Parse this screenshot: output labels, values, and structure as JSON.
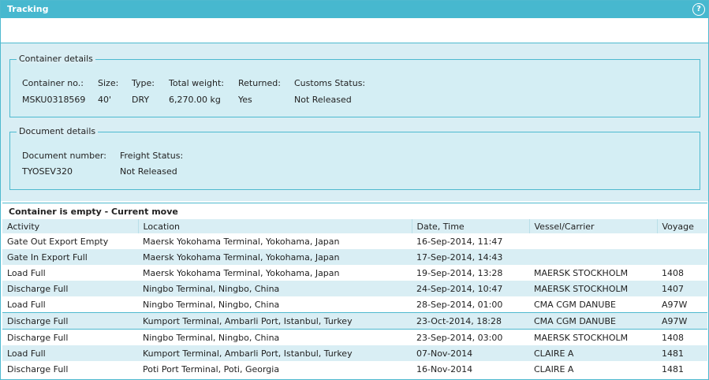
{
  "header": {
    "title": "Tracking",
    "help_icon": "?"
  },
  "container_details": {
    "legend": "Container details",
    "labels": [
      "Container no.:",
      "Size:",
      "Type:",
      "Total weight:",
      "Returned:",
      "Customs Status:"
    ],
    "values": [
      "MSKU0318569",
      "40'",
      "DRY",
      "6,270.00 kg",
      "Yes",
      "Not Released"
    ]
  },
  "document_details": {
    "legend": "Document details",
    "labels": [
      "Document number:",
      "Freight Status:"
    ],
    "values": [
      "TYOSEV320",
      "Not Released"
    ]
  },
  "moves": {
    "heading": "Container is empty - Current move",
    "columns": [
      "Activity",
      "Location",
      "Date, Time",
      "Vessel/Carrier",
      "Voyage"
    ],
    "rows": [
      [
        "Gate Out Export Empty",
        "Maersk Yokohama Terminal, Yokohama, Japan",
        "16-Sep-2014, 11:47",
        "",
        ""
      ],
      [
        "Gate In Export Full",
        "Maersk Yokohama Terminal, Yokohama, Japan",
        "17-Sep-2014, 14:43",
        "",
        ""
      ],
      [
        "Load Full",
        "Maersk Yokohama Terminal, Yokohama, Japan",
        "19-Sep-2014, 13:28",
        "MAERSK STOCKHOLM",
        "1408"
      ],
      [
        "Discharge Full",
        "Ningbo Terminal, Ningbo, China",
        "24-Sep-2014, 10:47",
        "MAERSK STOCKHOLM",
        "1407"
      ],
      [
        "Load Full",
        "Ningbo Terminal, Ningbo, China",
        "28-Sep-2014, 01:00",
        "CMA CGM DANUBE",
        "A97W"
      ],
      [
        "Discharge Full",
        "Kumport Terminal, Ambarli Port, Istanbul, Turkey",
        "23-Oct-2014, 18:28",
        "CMA CGM DANUBE",
        "A97W"
      ],
      [
        "Discharge Full",
        "Ningbo Terminal, Ningbo, China",
        "23-Sep-2014, 03:00",
        "MAERSK STOCKHOLM",
        "1408"
      ],
      [
        "Load Full",
        "Kumport Terminal, Ambarli Port, Istanbul, Turkey",
        "07-Nov-2014",
        "CLAIRE A",
        "1481"
      ],
      [
        "Discharge Full",
        "Poti Port Terminal, Poti, Georgia",
        "16-Nov-2014",
        "CLAIRE A",
        "1481"
      ]
    ]
  }
}
